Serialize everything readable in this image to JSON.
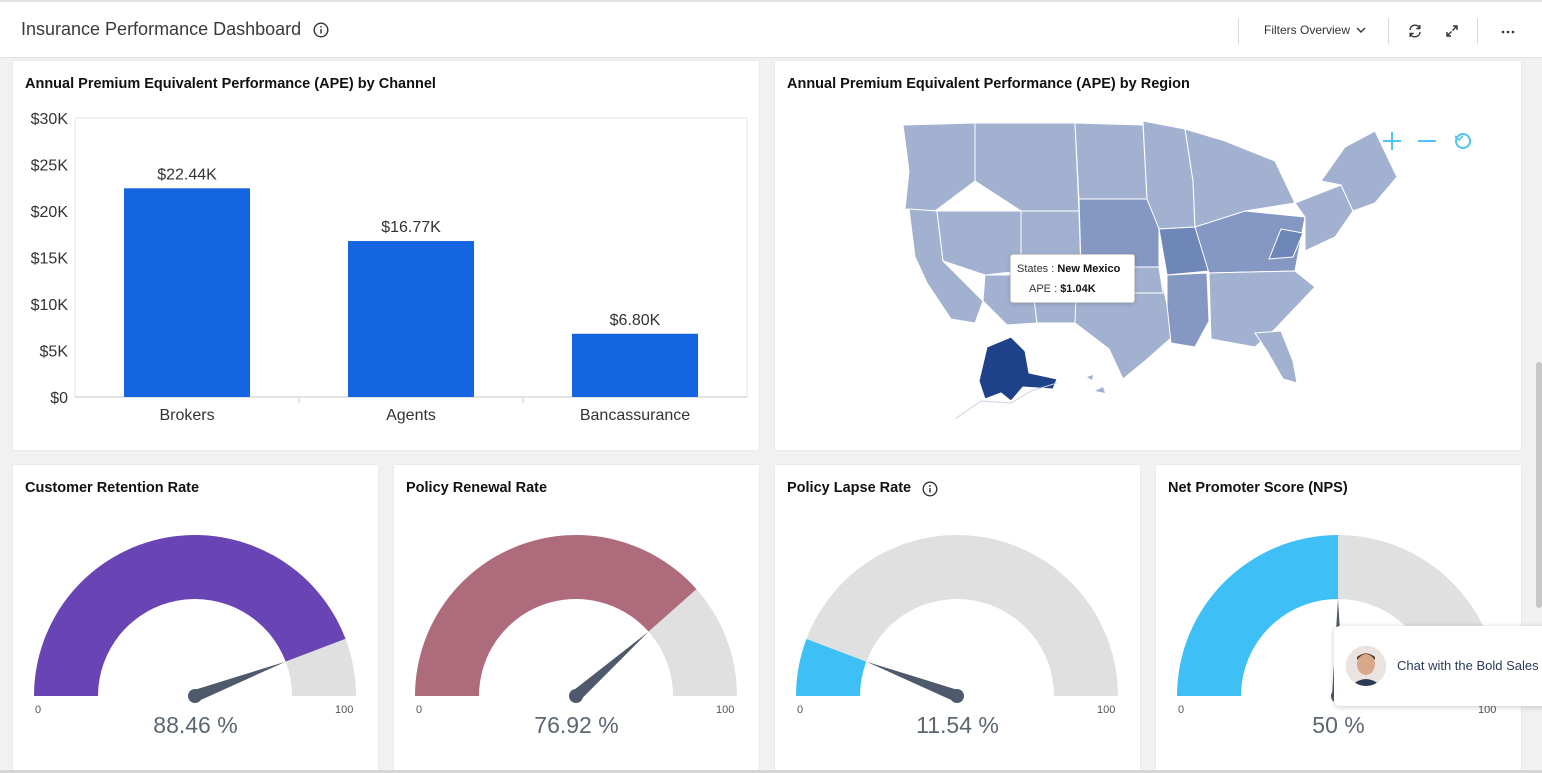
{
  "header": {
    "title": "Insurance Performance Dashboard",
    "filters_label": "Filters Overview",
    "icons": [
      "info-icon",
      "chevron-down-icon",
      "refresh-icon",
      "expand-icon",
      "more-icon"
    ]
  },
  "ape_channel": {
    "title": "Annual Premium Equivalent Performance (APE) by Channel"
  },
  "chart_data": {
    "type": "bar",
    "categories": [
      "Brokers",
      "Agents",
      "Bancassurance"
    ],
    "values": [
      22440,
      16770,
      6800
    ],
    "data_labels": [
      "$22.44K",
      "$16.77K",
      "$6.80K"
    ],
    "ytick_labels": [
      "$0",
      "$5K",
      "$10K",
      "$15K",
      "$20K",
      "$25K",
      "$30K"
    ],
    "ylim": [
      0,
      30000
    ],
    "bar_color": "#1565e0"
  },
  "ape_region": {
    "title": "Annual Premium Equivalent Performance (APE) by Region",
    "tooltip": {
      "states_label": "States :",
      "states_value": "New Mexico",
      "ape_label": "APE :",
      "ape_value": "$1.04K"
    },
    "map_controls": [
      "zoom-in-icon",
      "zoom-out-icon",
      "reset-icon"
    ],
    "colors": {
      "base": "#a3b1d1",
      "mid": "#8598c4",
      "dark": "#6f86b8",
      "highlight": "#1e428a",
      "control": "#4fc3f7"
    }
  },
  "gauges": [
    {
      "title": "Customer Retention Rate",
      "value": 88.46,
      "value_text": "88.46 %",
      "min": "0",
      "max": "100",
      "color": "#6844b4",
      "info": false
    },
    {
      "title": "Policy Renewal Rate",
      "value": 76.92,
      "value_text": "76.92 %",
      "min": "0",
      "max": "100",
      "color": "#ad6b7c",
      "info": false
    },
    {
      "title": "Policy Lapse Rate",
      "value": 11.54,
      "value_text": "11.54 %",
      "min": "0",
      "max": "100",
      "color": "#3ec0f7",
      "info": true
    },
    {
      "title": "Net Promoter Score (NPS)",
      "value": 50,
      "value_text": "50 %",
      "min": "0",
      "max": "100",
      "color": "#3ec0f7",
      "info": false
    }
  ],
  "chat": {
    "text": "Chat with the Bold Sales"
  }
}
